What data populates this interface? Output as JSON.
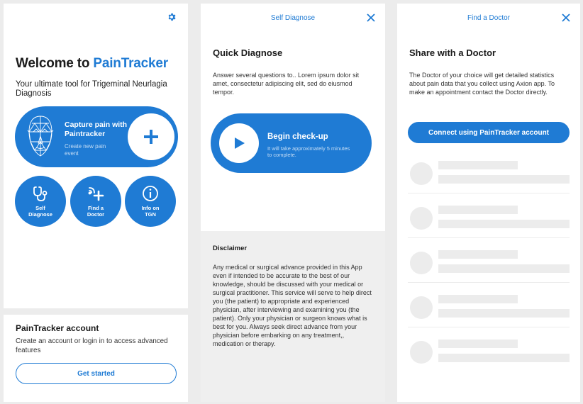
{
  "screen1": {
    "welcome_prefix": "Welcome to",
    "brand": "PainTracker",
    "tagline": "Your ultimate tool for Trigeminal Neurlagia Diagnosis",
    "capture": {
      "title": "Capture pain with Paintracker",
      "subtitle": "Create new pain event"
    },
    "actions": [
      {
        "label": "Self\nDiagnose",
        "icon": "stethoscope-icon"
      },
      {
        "label": "Find a\nDoctor",
        "icon": "doctor-signal-plus-icon"
      },
      {
        "label": "Info on\nTGN",
        "icon": "info-icon"
      }
    ],
    "account": {
      "title": "PainTracker account",
      "description": "Create an account or login in to access advanced features",
      "cta": "Get started"
    }
  },
  "screen2": {
    "header": "Self Diagnose",
    "title": "Quick Diagnose",
    "description": "Answer several questions to.. Lorem ipsum dolor sit amet, consectetur adipiscing elit, sed do eiusmod tempor.",
    "checkup": {
      "title": "Begin check-up",
      "subtitle": "It will take approximately 5 minutes to complete."
    },
    "disclaimer": {
      "title": "Disclaimer",
      "body": "Any medical or surgical advance provided in this App even if intended to be accurate to the best of our knowledge, should be discussed with your medical or surgical practitioner. This service will serve to help direct you (the patient) to appropriate and experienced physician, after interviewing and examining you (the patient). Only your physician or surgeon knows what is best for you. Always seek direct advance from your physician before embarking on any treatment,, medication or therapy."
    }
  },
  "screen3": {
    "header": "Find a Doctor",
    "title": "Share with a Doctor",
    "description": "The Doctor of your choice will get detailed statistics about pain data that you collect using Axion app. To make an appointment contact the Doctor directly.",
    "cta": "Connect using PainTracker account",
    "placeholder_rows": 5
  },
  "colors": {
    "accent": "#1f7bd4",
    "skeleton": "#ececec",
    "background": "#ececec"
  }
}
